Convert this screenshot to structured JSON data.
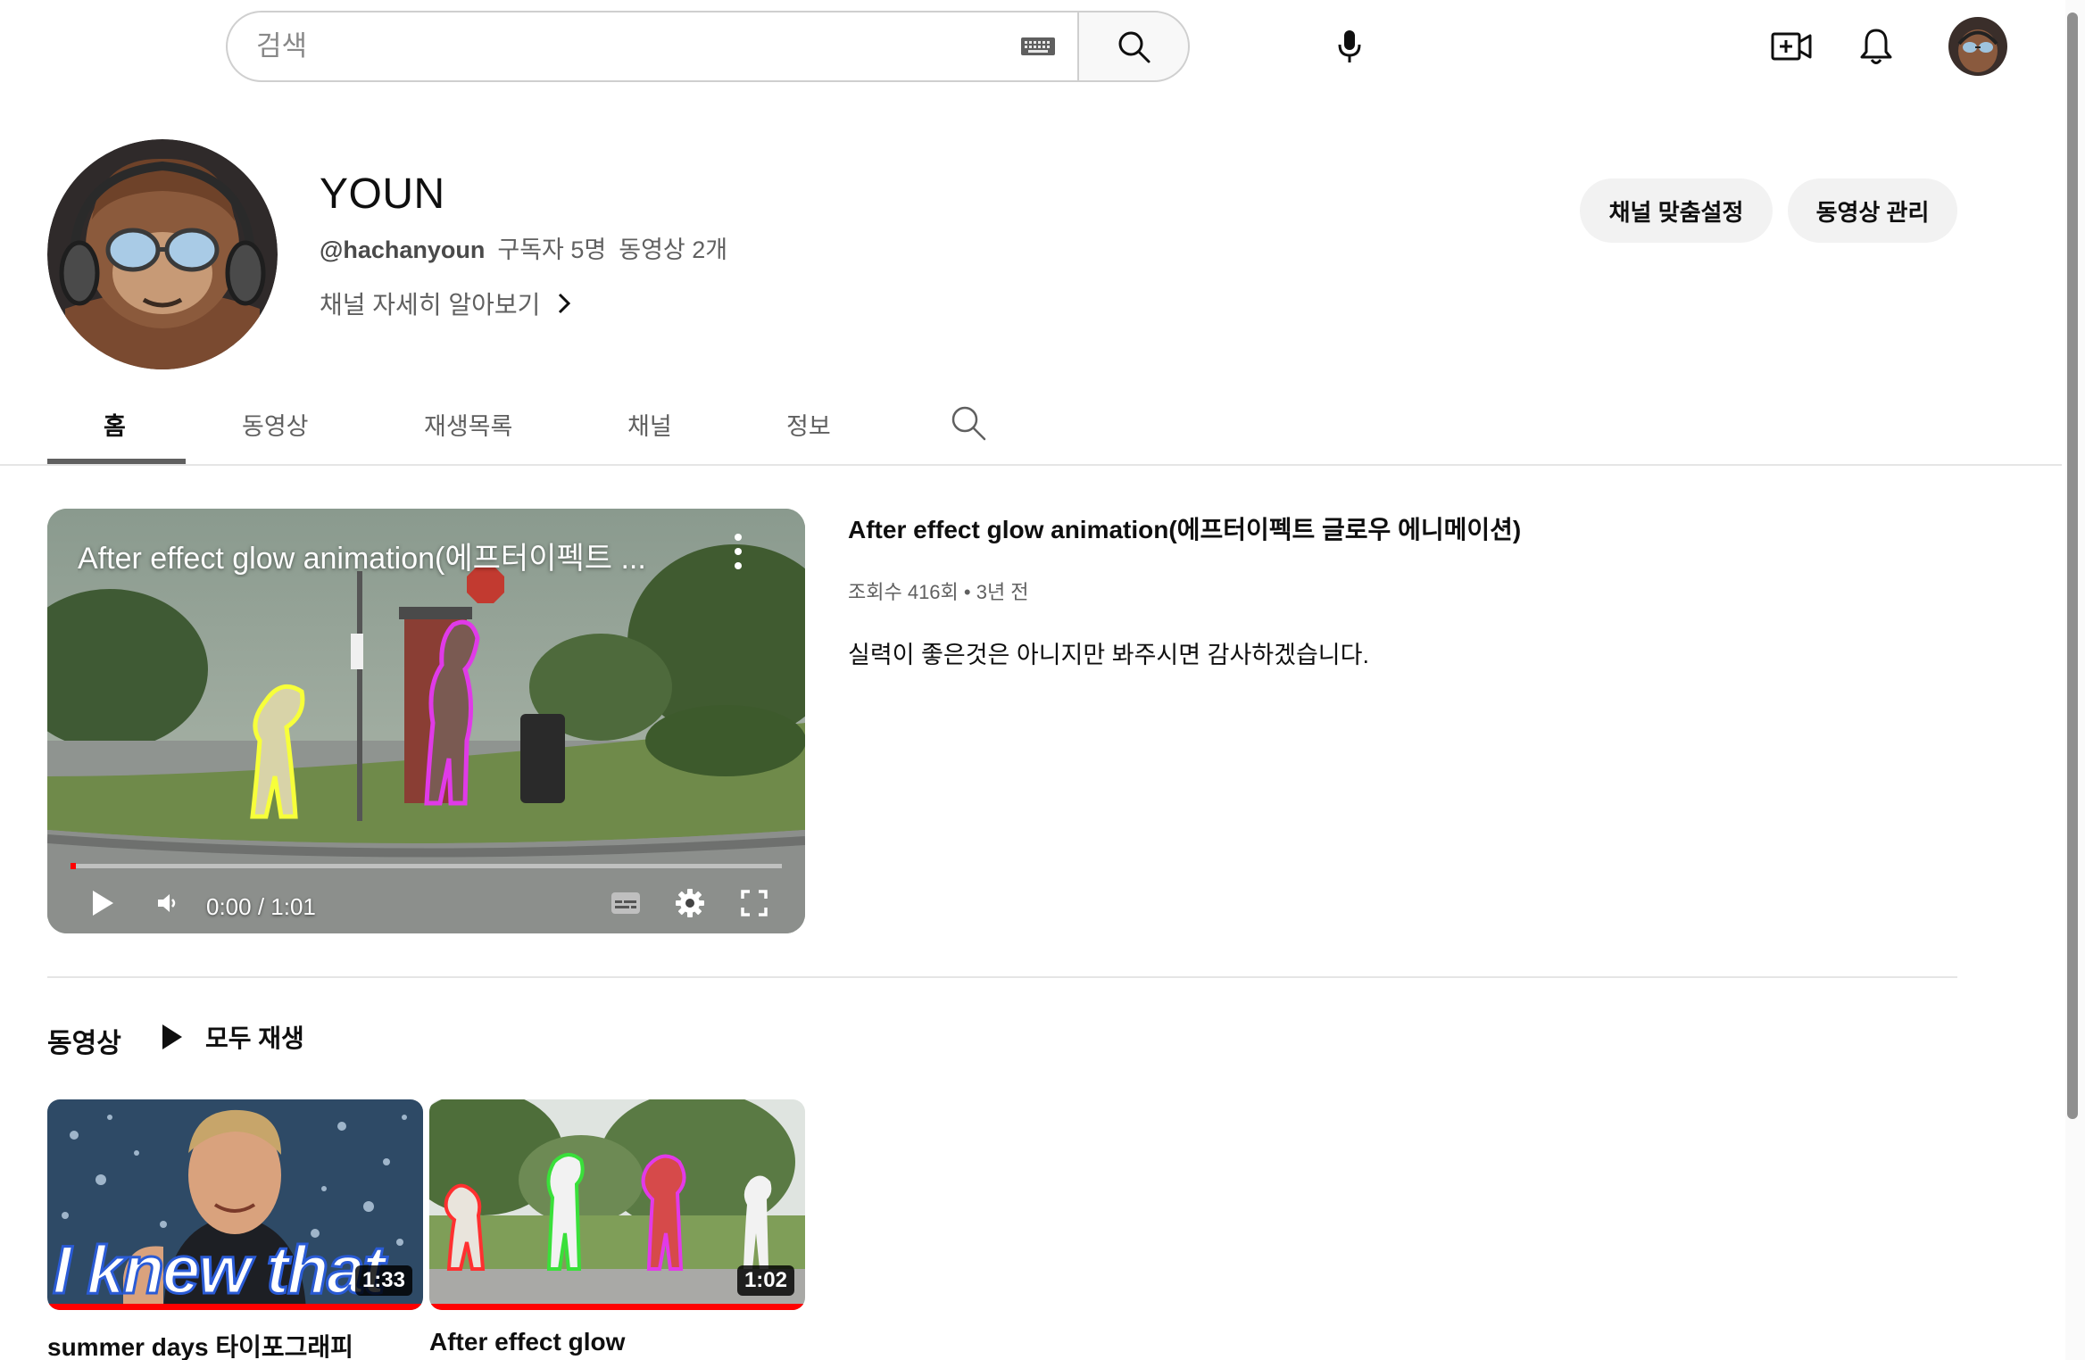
{
  "search": {
    "placeholder": "검색"
  },
  "channel": {
    "name": "YOUN",
    "handle": "@hachanyoun",
    "subscribers": "구독자 5명",
    "video_count": "동영상 2개",
    "about_label": "채널 자세히 알아보기",
    "buttons": {
      "customize": "채널 맞춤설정",
      "manage": "동영상 관리"
    }
  },
  "tabs": [
    {
      "label": "홈",
      "active": true
    },
    {
      "label": "동영상"
    },
    {
      "label": "재생목록"
    },
    {
      "label": "채널"
    },
    {
      "label": "정보"
    }
  ],
  "featured": {
    "overlay_title": "After effect glow animation(에프터이펙트 ...",
    "title": "After effect glow animation(에프터이펙트 글로우 에니메이션)",
    "meta": "조회수 416회 • 3년 전",
    "description": "실력이 좋은것은 아니지만 봐주시면 감사하겠습니다.",
    "time": "0:00 / 1:01",
    "progress_fraction": 0.0
  },
  "shelf": {
    "title": "동영상",
    "play_all": "모두 재생",
    "videos": [
      {
        "title": "summer days 타이포그래피",
        "duration": "1:33",
        "thumb_text": "I knew that"
      },
      {
        "title": "After effect glow",
        "duration": "1:02"
      }
    ]
  },
  "colors": {
    "accent": "#ff0000",
    "text_secondary": "#606060",
    "button_bg": "#f2f2f2"
  }
}
